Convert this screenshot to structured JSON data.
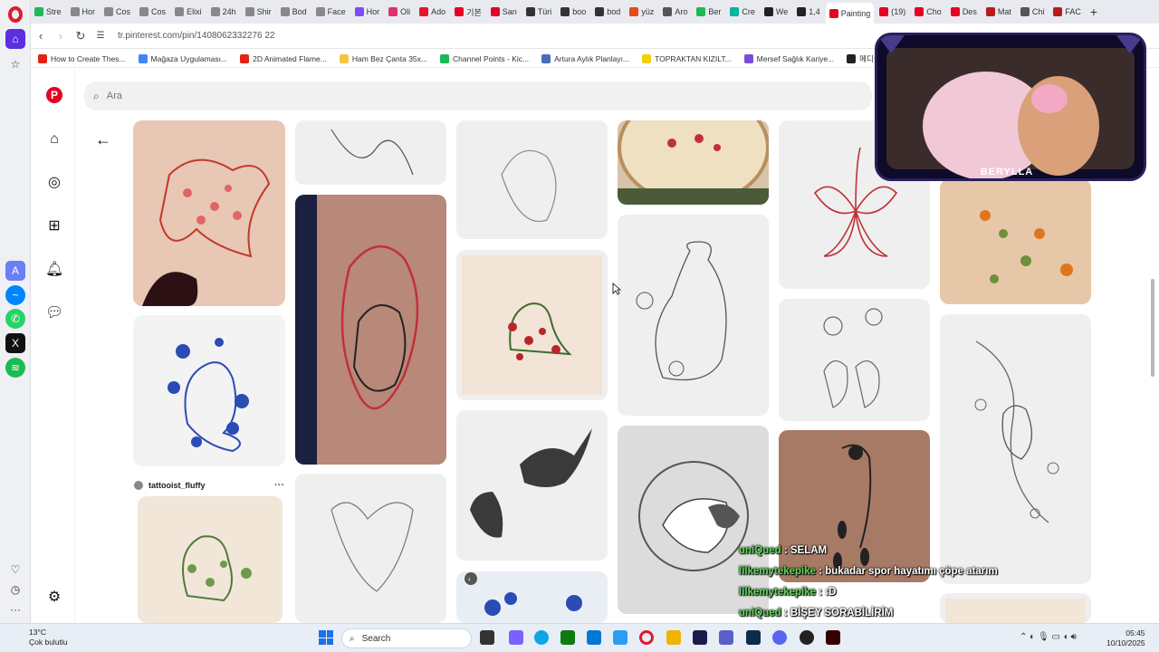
{
  "browser": {
    "tabs": [
      {
        "label": "Stre",
        "color": "#1db954"
      },
      {
        "label": "Hor",
        "color": "#888888"
      },
      {
        "label": "Cos",
        "color": "#888888"
      },
      {
        "label": "Cos",
        "color": "#888888"
      },
      {
        "label": "Elixi",
        "color": "#888888"
      },
      {
        "label": "24h",
        "color": "#888888"
      },
      {
        "label": "Shir",
        "color": "#888888"
      },
      {
        "label": "Bod",
        "color": "#888888"
      },
      {
        "label": "Face",
        "color": "#888888"
      },
      {
        "label": "Hor",
        "color": "#7c4dff"
      },
      {
        "label": "Oli",
        "color": "#e1306c"
      },
      {
        "label": "Ado",
        "color": "#e2192c"
      },
      {
        "label": "기본",
        "color": "#e60023"
      },
      {
        "label": "San",
        "color": "#e60023"
      },
      {
        "label": "Türi",
        "color": "#333333"
      },
      {
        "label": "boo",
        "color": "#333333"
      },
      {
        "label": "bod",
        "color": "#333333"
      },
      {
        "label": "yüz",
        "color": "#e64a19"
      },
      {
        "label": "Aro",
        "color": "#555555"
      },
      {
        "label": "Ber",
        "color": "#1db954"
      },
      {
        "label": "Cre",
        "color": "#00b4a0"
      },
      {
        "label": "We",
        "color": "#222222"
      },
      {
        "label": "1,4",
        "color": "#222222"
      },
      {
        "label": "Painting",
        "color": "#e60023",
        "active": true
      },
      {
        "label": "(19)",
        "color": "#e60023"
      },
      {
        "label": "Cho",
        "color": "#e60023"
      },
      {
        "label": "Des",
        "color": "#e60023"
      },
      {
        "label": "Mat",
        "color": "#b71c1c"
      },
      {
        "label": "Chi",
        "color": "#555555"
      },
      {
        "label": "FAC",
        "color": "#b71c1c"
      }
    ],
    "url": "tr.pinterest.com/pin/1408062332276 22",
    "bookmarks": [
      {
        "label": "How to Create Thes...",
        "color": "#e62117"
      },
      {
        "label": "Mağaza Uygulaması...",
        "color": "#4285f4"
      },
      {
        "label": "2D Animated Flame...",
        "color": "#e62117"
      },
      {
        "label": "Ham Bez Çanta 35x...",
        "color": "#f5c542"
      },
      {
        "label": "Channel Points - Kic...",
        "color": "#1db954"
      },
      {
        "label": "Artura Aylık Planlayı...",
        "color": "#4b6cb7"
      },
      {
        "label": "TOPRAKTAN KIZILT...",
        "color": "#f5d000"
      },
      {
        "label": "Mersef Sağlık Kariye...",
        "color": "#7b4dd6"
      },
      {
        "label": "메디플라워",
        "color": "#222222"
      }
    ]
  },
  "pinterest": {
    "logo": "P",
    "search_placeholder": "Ara",
    "nav_icons": [
      "home-icon",
      "explore-icon",
      "create-icon",
      "notifications-icon",
      "messages-icon",
      "settings-icon"
    ],
    "author": "tattooist_fluffy",
    "more": "···"
  },
  "stream": {
    "streamer_name": "BERYLLA",
    "chat": [
      {
        "user": "uniQued",
        "message": " : SELAM"
      },
      {
        "user": "lilkemytekepike",
        "message": " : bukadar spor hayatımı çöpe atarım"
      },
      {
        "user": "lilkemytekepike",
        "message": " : :D"
      },
      {
        "user": "uniQued",
        "message": " : BİŞEY SORABİLİRİM"
      }
    ]
  },
  "taskbar": {
    "weather_temp": "13°C",
    "weather_desc": "Çok bulutlu",
    "search_label": "Search",
    "time": "05:45",
    "date": "10/10/2025"
  }
}
